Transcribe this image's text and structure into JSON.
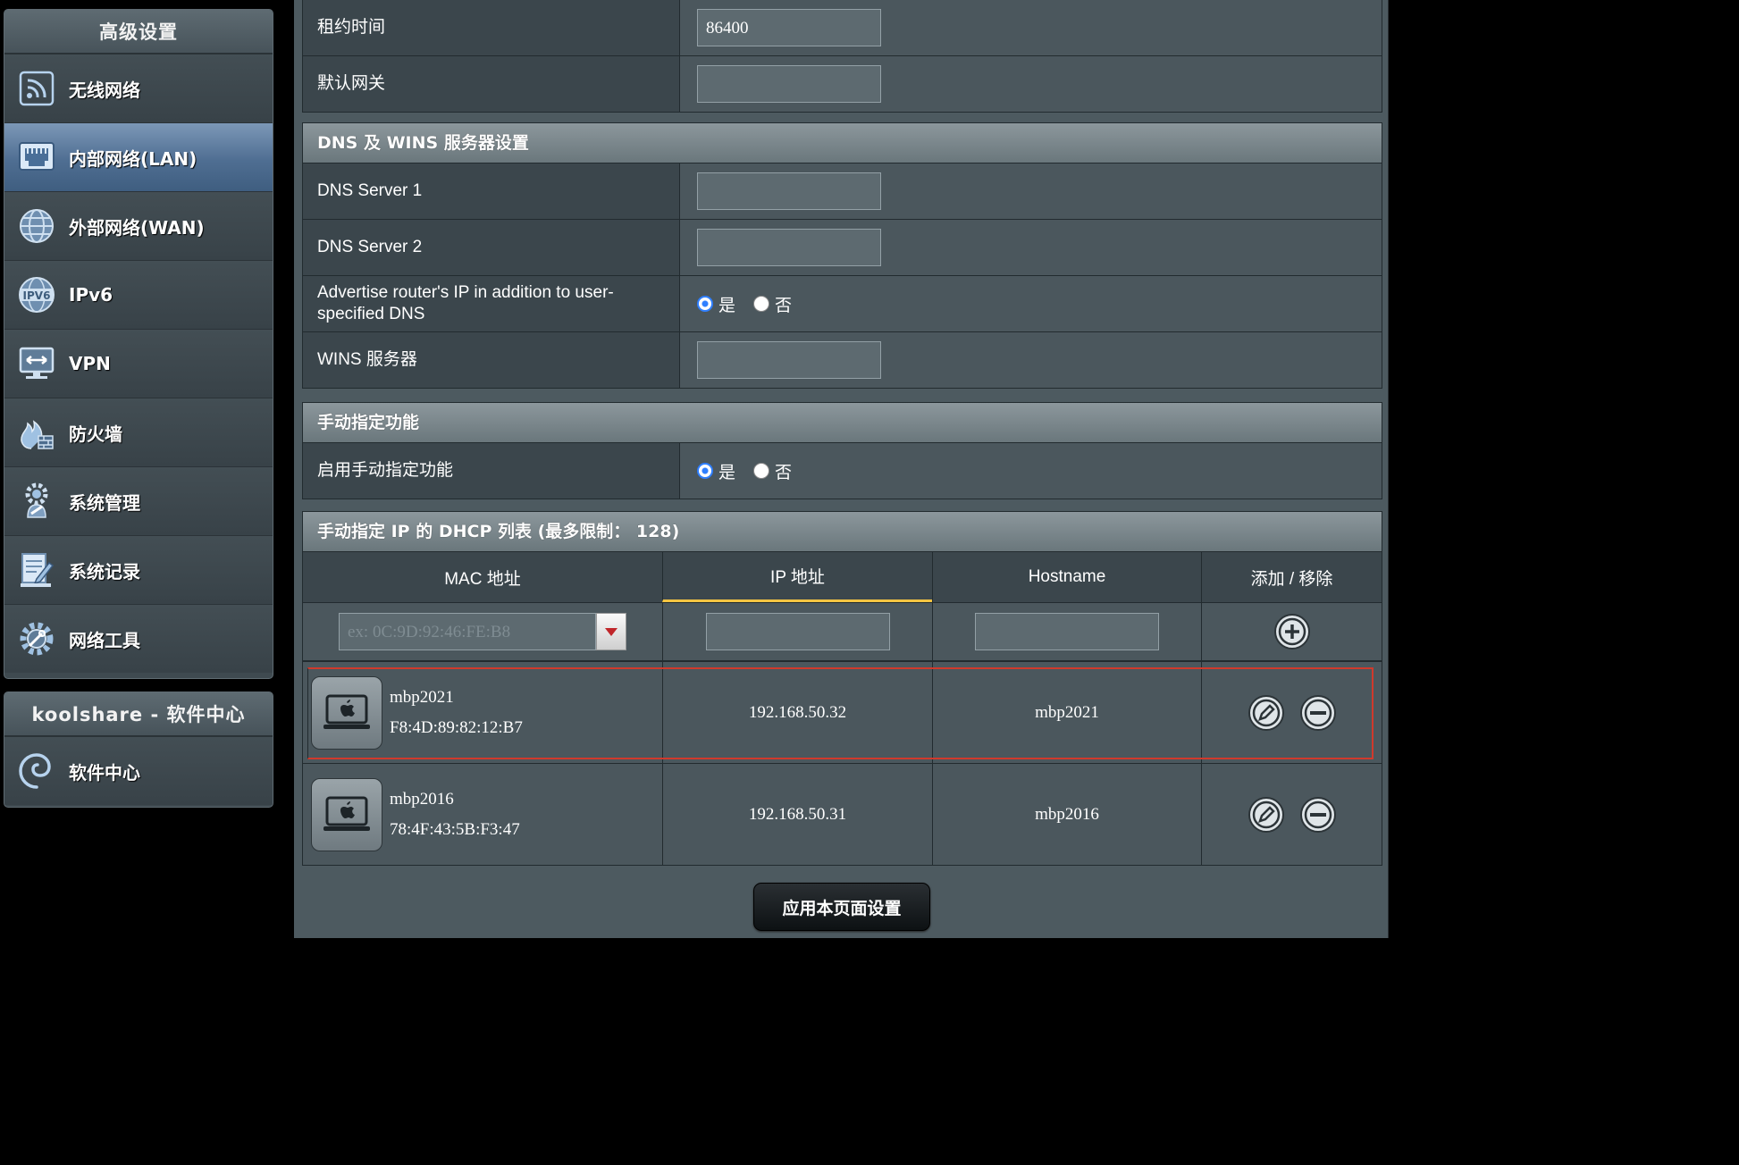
{
  "sidebar": {
    "section_title": "高级设置",
    "items": [
      {
        "label": "无线网络",
        "icon": "wireless-icon",
        "active": false
      },
      {
        "label": "内部网络(LAN)",
        "icon": "lan-icon",
        "active": true
      },
      {
        "label": "外部网络(WAN)",
        "icon": "globe-icon",
        "active": false
      },
      {
        "label": "IPv6",
        "icon": "ipv6-icon",
        "active": false
      },
      {
        "label": "VPN",
        "icon": "vpn-icon",
        "active": false
      },
      {
        "label": "防火墙",
        "icon": "firewall-icon",
        "active": false
      },
      {
        "label": "系统管理",
        "icon": "gear-person-icon",
        "active": false
      },
      {
        "label": "系统记录",
        "icon": "log-icon",
        "active": false
      },
      {
        "label": "网络工具",
        "icon": "tools-icon",
        "active": false
      }
    ],
    "software_title": "koolshare - 软件中心",
    "software_item": {
      "label": "软件中心",
      "icon": "swirl-icon"
    }
  },
  "lease": {
    "label": "租约时间",
    "value": "86400"
  },
  "gateway": {
    "label": "默认网关",
    "value": ""
  },
  "dns": {
    "section_title": "DNS 及 WINS 服务器设置",
    "server1_label": "DNS Server 1",
    "server1_value": "",
    "server2_label": "DNS Server 2",
    "server2_value": "",
    "advertise_label": "Advertise router's IP in addition to user-specified DNS",
    "yes": "是",
    "no": "否",
    "advertise_selected": "yes",
    "wins_label": "WINS 服务器",
    "wins_value": ""
  },
  "manual": {
    "section_title": "手动指定功能",
    "enable_label": "启用手动指定功能",
    "yes": "是",
    "no": "否",
    "selected": "yes"
  },
  "dhcp_list": {
    "section_title": "手动指定 IP 的 DHCP 列表 (最多限制： 128)",
    "columns": [
      "MAC 地址",
      "IP 地址",
      "Hostname",
      "添加 / 移除"
    ],
    "mac_placeholder": "ex: 0C:9D:92:46:FE:B8",
    "rows": [
      {
        "name": "mbp2021",
        "mac": "F8:4D:89:82:12:B7",
        "ip": "192.168.50.32",
        "hostname": "mbp2021"
      },
      {
        "name": "mbp2016",
        "mac": "78:4F:43:5B:F3:47",
        "ip": "192.168.50.31",
        "hostname": "mbp2016"
      }
    ]
  },
  "apply_label": "应用本页面设置",
  "colors": {
    "accent_tab": "#f5c542",
    "highlight_border": "#d03a2c",
    "radio_on": "#2f7fff"
  }
}
